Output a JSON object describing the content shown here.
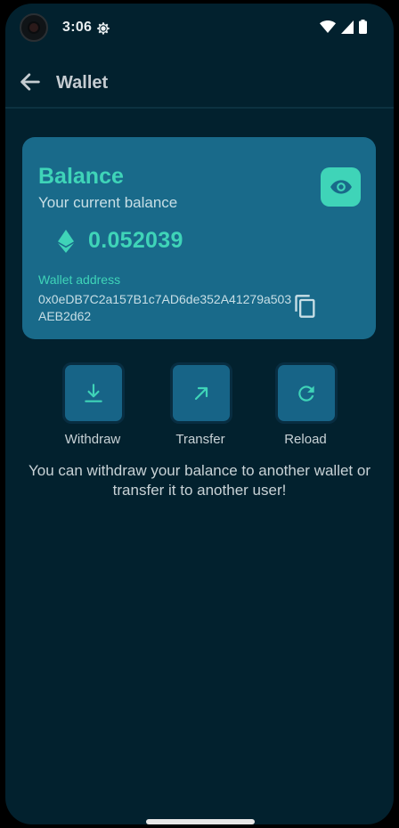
{
  "status_bar": {
    "time": "3:06",
    "icons": [
      "camera-cutout",
      "settings-gear-icon",
      "wifi-icon",
      "signal-icon",
      "battery-icon"
    ]
  },
  "app_bar": {
    "title": "Wallet",
    "back_icon": "arrow-back-icon"
  },
  "balance_card": {
    "title": "Balance",
    "subtitle": "Your current balance",
    "amount": "0.052039",
    "currency_icon": "ethereum-icon",
    "visibility_icon": "eye-icon",
    "wallet_label": "Wallet address",
    "wallet_address": "0x0eDB7C2a157B1c7AD6de352A41279a503AEB2d62",
    "copy_icon": "copy-icon"
  },
  "actions": [
    {
      "label": "Withdraw",
      "icon": "download-icon"
    },
    {
      "label": "Transfer",
      "icon": "arrow-up-right-icon"
    },
    {
      "label": "Reload",
      "icon": "refresh-icon"
    }
  ],
  "info_text": "You can withdraw your balance to another wallet or transfer it to another user!",
  "colors": {
    "background": "#02212e",
    "card": "#196a8a",
    "accent": "#3fd4b8",
    "action_tile": "#176487"
  }
}
